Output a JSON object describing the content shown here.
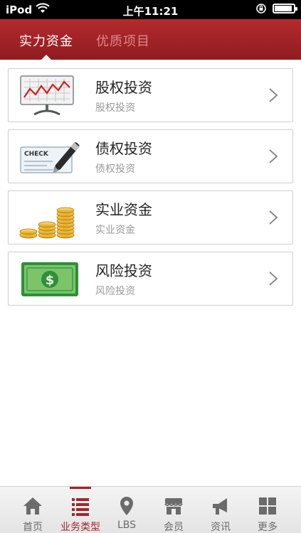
{
  "status_bar": {
    "carrier": "iPod",
    "time": "上午11:21"
  },
  "tabs": [
    {
      "label": "实力资金",
      "active": true
    },
    {
      "label": "优质项目",
      "active": false
    }
  ],
  "items": [
    {
      "title": "股权投资",
      "subtitle": "股权投资",
      "icon": "chart-board-icon"
    },
    {
      "title": "债权投资",
      "subtitle": "债权投资",
      "icon": "check-pen-icon",
      "icon_text": "CHECK"
    },
    {
      "title": "实业资金",
      "subtitle": "实业资金",
      "icon": "gold-coins-icon"
    },
    {
      "title": "风险投资",
      "subtitle": "风险投资",
      "icon": "dollar-bill-icon",
      "icon_text": "$"
    }
  ],
  "bottom_nav": [
    {
      "label": "首页",
      "icon": "home-icon",
      "active": false
    },
    {
      "label": "业务类型",
      "icon": "list-icon",
      "active": true
    },
    {
      "label": "LBS",
      "icon": "location-pin-icon",
      "active": false
    },
    {
      "label": "会员",
      "icon": "shop-icon",
      "active": false
    },
    {
      "label": "资讯",
      "icon": "megaphone-icon",
      "active": false
    },
    {
      "label": "更多",
      "icon": "grid-icon",
      "active": false
    }
  ],
  "colors": {
    "header_red": "#a3262a",
    "active_nav": "#a3262a"
  }
}
